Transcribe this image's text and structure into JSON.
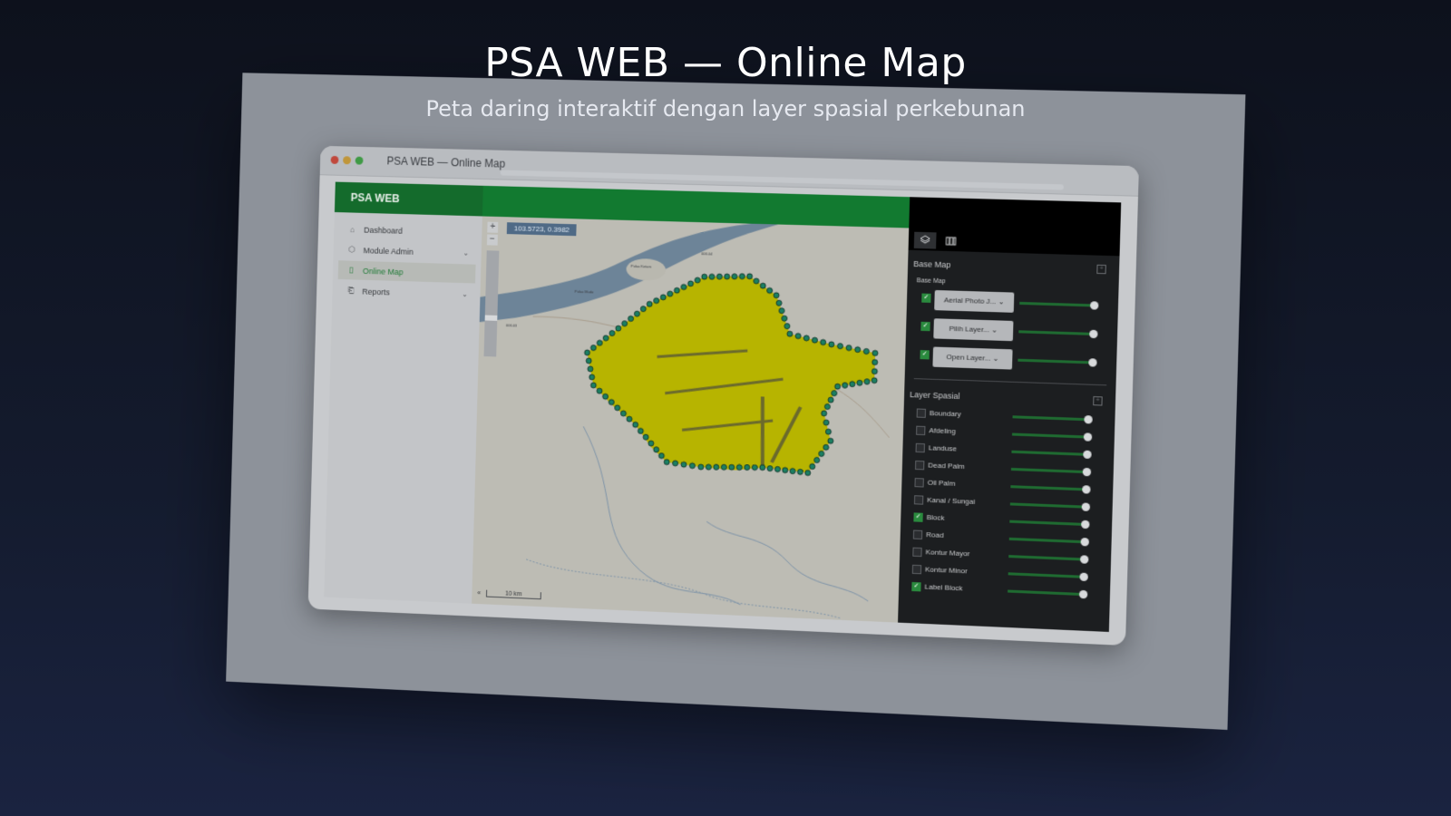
{
  "hero": {
    "title": "PSA WEB — Online Map",
    "subtitle": "Peta daring interaktif dengan layer spasial perkebunan"
  },
  "window": {
    "title": "PSA WEB — Online Map"
  },
  "app": {
    "brand": "PSA WEB",
    "nav": [
      {
        "label": "Dashboard",
        "icon": "home-icon",
        "active": false,
        "expandable": false
      },
      {
        "label": "Module Admin",
        "icon": "cube-icon",
        "active": false,
        "expandable": true
      },
      {
        "label": "Online Map",
        "icon": "map-icon",
        "active": true,
        "expandable": false
      },
      {
        "label": "Reports",
        "icon": "report-icon",
        "active": false,
        "expandable": true
      }
    ]
  },
  "map": {
    "coordinates": "103.5723, 0.3982",
    "scale_label": "10 km",
    "labels": [
      "Pulau Ketam",
      "Pulau Mudo",
      "006.04",
      "006.03"
    ],
    "colors": {
      "plantation": "#b7b400",
      "point": "#1b7f62",
      "water": "#5f7a93"
    }
  },
  "panel": {
    "base_map_section": "Base Map",
    "base_map_sub": "Base Map",
    "base_maps": [
      {
        "label": "Aerial Photo J...",
        "checked": true,
        "opacity": 0.9
      },
      {
        "label": "Pilih Layer...",
        "checked": true,
        "opacity": 0.9
      },
      {
        "label": "Open Layer...",
        "checked": true,
        "opacity": 0.9
      }
    ],
    "layer_section": "Layer Spasial",
    "layers": [
      {
        "label": "Boundary",
        "checked": false
      },
      {
        "label": "Afdeling",
        "checked": false
      },
      {
        "label": "Landuse",
        "checked": false
      },
      {
        "label": "Dead Palm",
        "checked": false
      },
      {
        "label": "Oil Palm",
        "checked": false
      },
      {
        "label": "Kanal / Sungai",
        "checked": false
      },
      {
        "label": "Block",
        "checked": true
      },
      {
        "label": "Road",
        "checked": false
      },
      {
        "label": "Kontur Mayor",
        "checked": false
      },
      {
        "label": "Kontur Minor",
        "checked": false
      },
      {
        "label": "Label Block",
        "checked": true
      }
    ]
  }
}
